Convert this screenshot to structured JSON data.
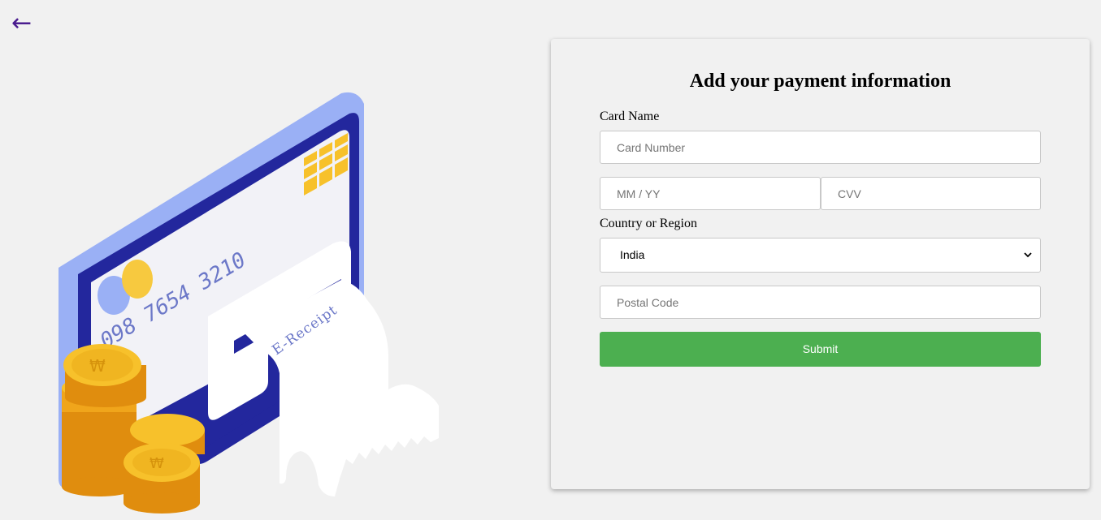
{
  "nav": {
    "back_label": "←"
  },
  "illustration": {
    "card_number_text": "098 7654 3210",
    "receipt_text": "E-Receipt"
  },
  "form": {
    "title": "Add your payment information",
    "card_name_label": "Card Name",
    "card_number_placeholder": "Card Number",
    "expiry_placeholder": "MM / YY",
    "cvv_placeholder": "CVV",
    "country_label": "Country or Region",
    "country_selected": "India",
    "postal_code_placeholder": "Postal Code",
    "submit_label": "Submit"
  },
  "colors": {
    "page_background": "#f1f1f1",
    "accent_purple": "#4b1d8f",
    "submit_green": "#4caf50",
    "card_navy": "#23279d",
    "card_light_blue": "#9ab0f5",
    "coin_gold": "#f7c12b"
  }
}
